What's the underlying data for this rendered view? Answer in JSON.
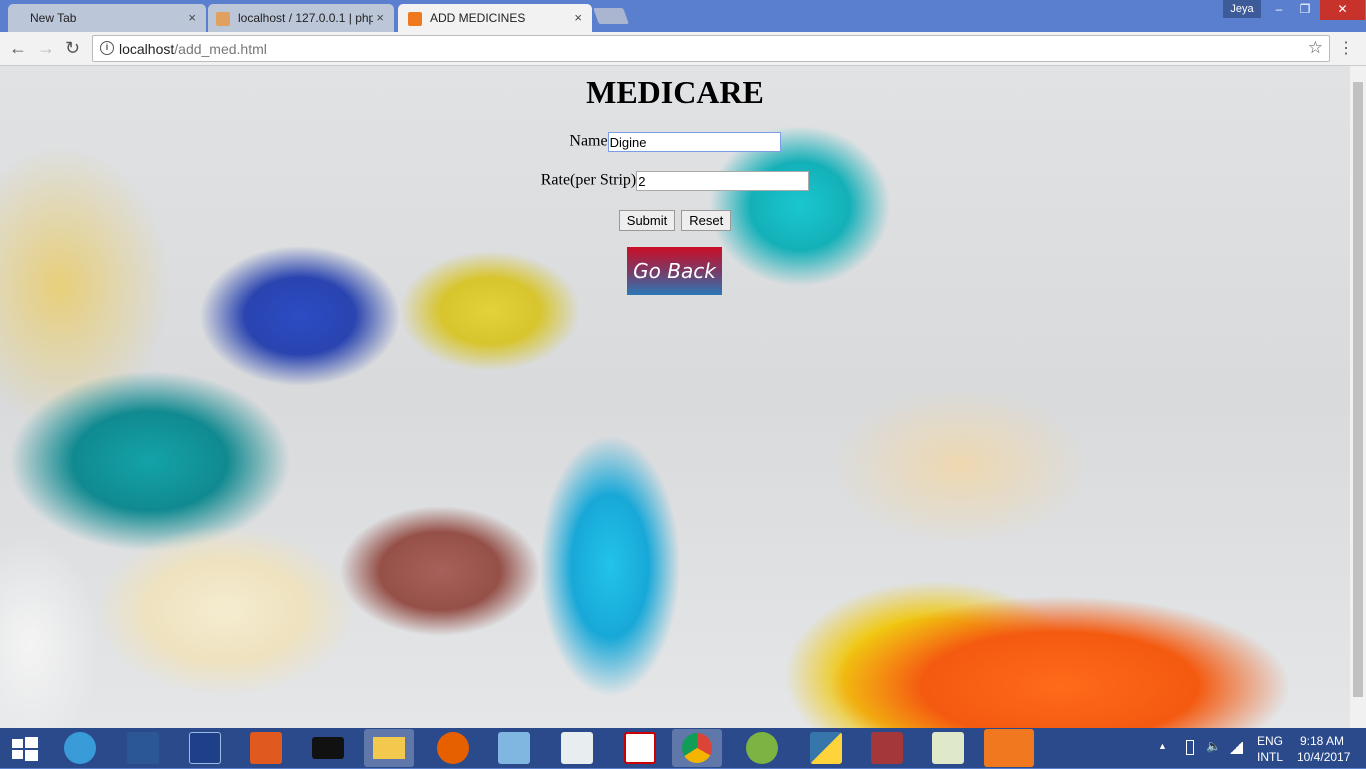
{
  "browser": {
    "tabs": [
      {
        "label": "New Tab",
        "icon": "blank-page-icon",
        "close": "×"
      },
      {
        "label": "localhost / 127.0.0.1 | php",
        "icon": "phpmyadmin-icon",
        "close": "×"
      },
      {
        "label": "ADD MEDICINES",
        "icon": "xampp-icon",
        "close": "×",
        "active": true
      }
    ],
    "user": "Jeya",
    "window_controls": {
      "minimize": "–",
      "restore": "❐",
      "close": "✕"
    },
    "nav": {
      "back": "←",
      "forward": "→",
      "reload": "↻"
    },
    "url_host": "localhost",
    "url_path": "/add_med.html",
    "info_icon": "i",
    "star": "☆",
    "menu": "⋮"
  },
  "page": {
    "title": "MEDICARE",
    "form": {
      "name_label": "Name",
      "name_value": "Digine",
      "rate_label": "Rate(per Strip)",
      "rate_value": "2",
      "submit": "Submit",
      "reset": "Reset"
    },
    "go_back": "Go Back"
  },
  "taskbar": {
    "apps": [
      "windows-start",
      "internet-explorer",
      "word",
      "dev-cpp",
      "headphones-app",
      "command-prompt",
      "file-explorer",
      "firefox",
      "notepad-pen",
      "document-viewer",
      "acrobat-reader",
      "chrome",
      "android-studio",
      "python",
      "access",
      "notepad-plus",
      "xampp"
    ],
    "tray": {
      "lang1": "ENG",
      "lang2": "INTL",
      "time": "9:18 AM",
      "date": "10/4/2017",
      "arrow": "▲",
      "volume": "🔈"
    }
  }
}
